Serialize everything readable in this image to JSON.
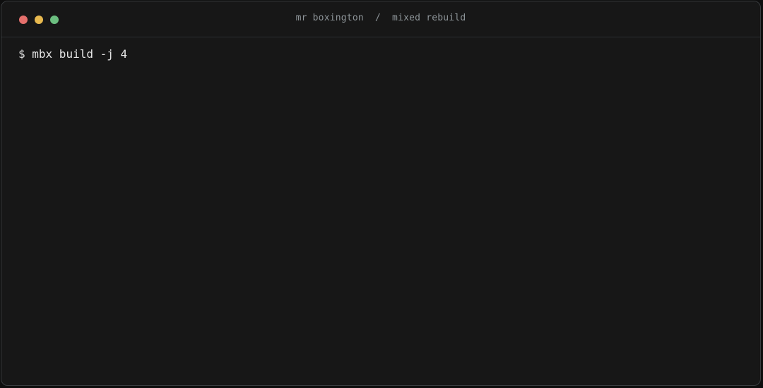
{
  "window": {
    "title_left": "mr boxington",
    "title_separator": "  /  ",
    "title_right": "mixed rebuild",
    "controls": {
      "close_color": "#e5706c",
      "minimize_color": "#e8b94f",
      "maximize_color": "#6cbf80"
    }
  },
  "terminal": {
    "lines": [
      {
        "prompt": "$",
        "command": " mbx build -j 4"
      }
    ]
  }
}
